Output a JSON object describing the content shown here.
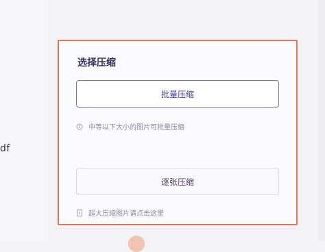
{
  "left_text": "df",
  "panel": {
    "title": "选择压缩",
    "primary_button_label": "批量压缩",
    "primary_hint": "中等以下大小的图片可批量压缩",
    "secondary_button_label": "逐张压缩",
    "secondary_hint": "超大压缩图片请点击这里",
    "hint_icon": "info-icon",
    "border_color": "#e8735a"
  }
}
